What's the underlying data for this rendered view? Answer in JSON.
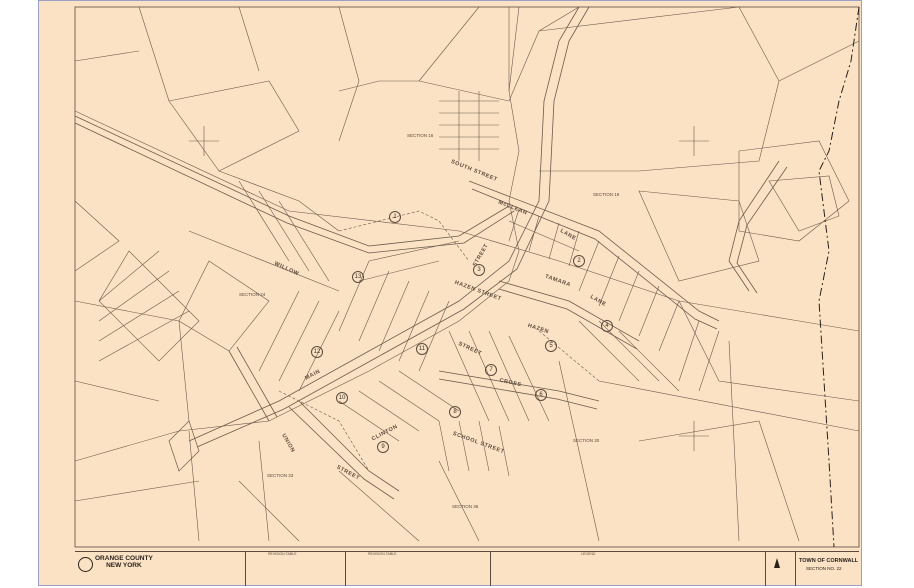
{
  "county": {
    "line1": "ORANGE COUNTY",
    "line2": "NEW YORK"
  },
  "town": {
    "name": "TOWN OF CORNWALL",
    "section_label": "SECTION NO.",
    "section_no": "22"
  },
  "tables": {
    "revision_1": "REVISION TABLE",
    "revision_2": "REVISION TABLE",
    "legend": "LEGEND"
  },
  "streets": {
    "south": "SOUTH STREET",
    "mcclean": "McCLEAN",
    "lane1": "LANE",
    "tamara": "TAMARA",
    "lane2": "LANE",
    "hazen1": "HAZEN STREET",
    "hazen2": "HAZEN",
    "street_a": "STREET",
    "street_b": "STREET",
    "willow": "WILLOW",
    "main": "MAIN",
    "clinton": "CLINTON",
    "street_c": "STREET",
    "school": "SCHOOL STREET",
    "cross": "CROSS",
    "union": "UNION"
  },
  "sections": {
    "s16_top": "SECTION 16",
    "s19": "SECTION 19",
    "s24": "SECTION 24",
    "s30": "SECTION 30",
    "s33": "SECTION 33",
    "s36": "SECTION 36"
  },
  "blocks": [
    "1",
    "2",
    "3",
    "4",
    "5",
    "6",
    "7",
    "8",
    "9",
    "10",
    "11",
    "12",
    "13"
  ],
  "colors": {
    "paper": "#fbe2c4",
    "ink": "#5b4a3c",
    "frame": "#9aa0c8"
  }
}
